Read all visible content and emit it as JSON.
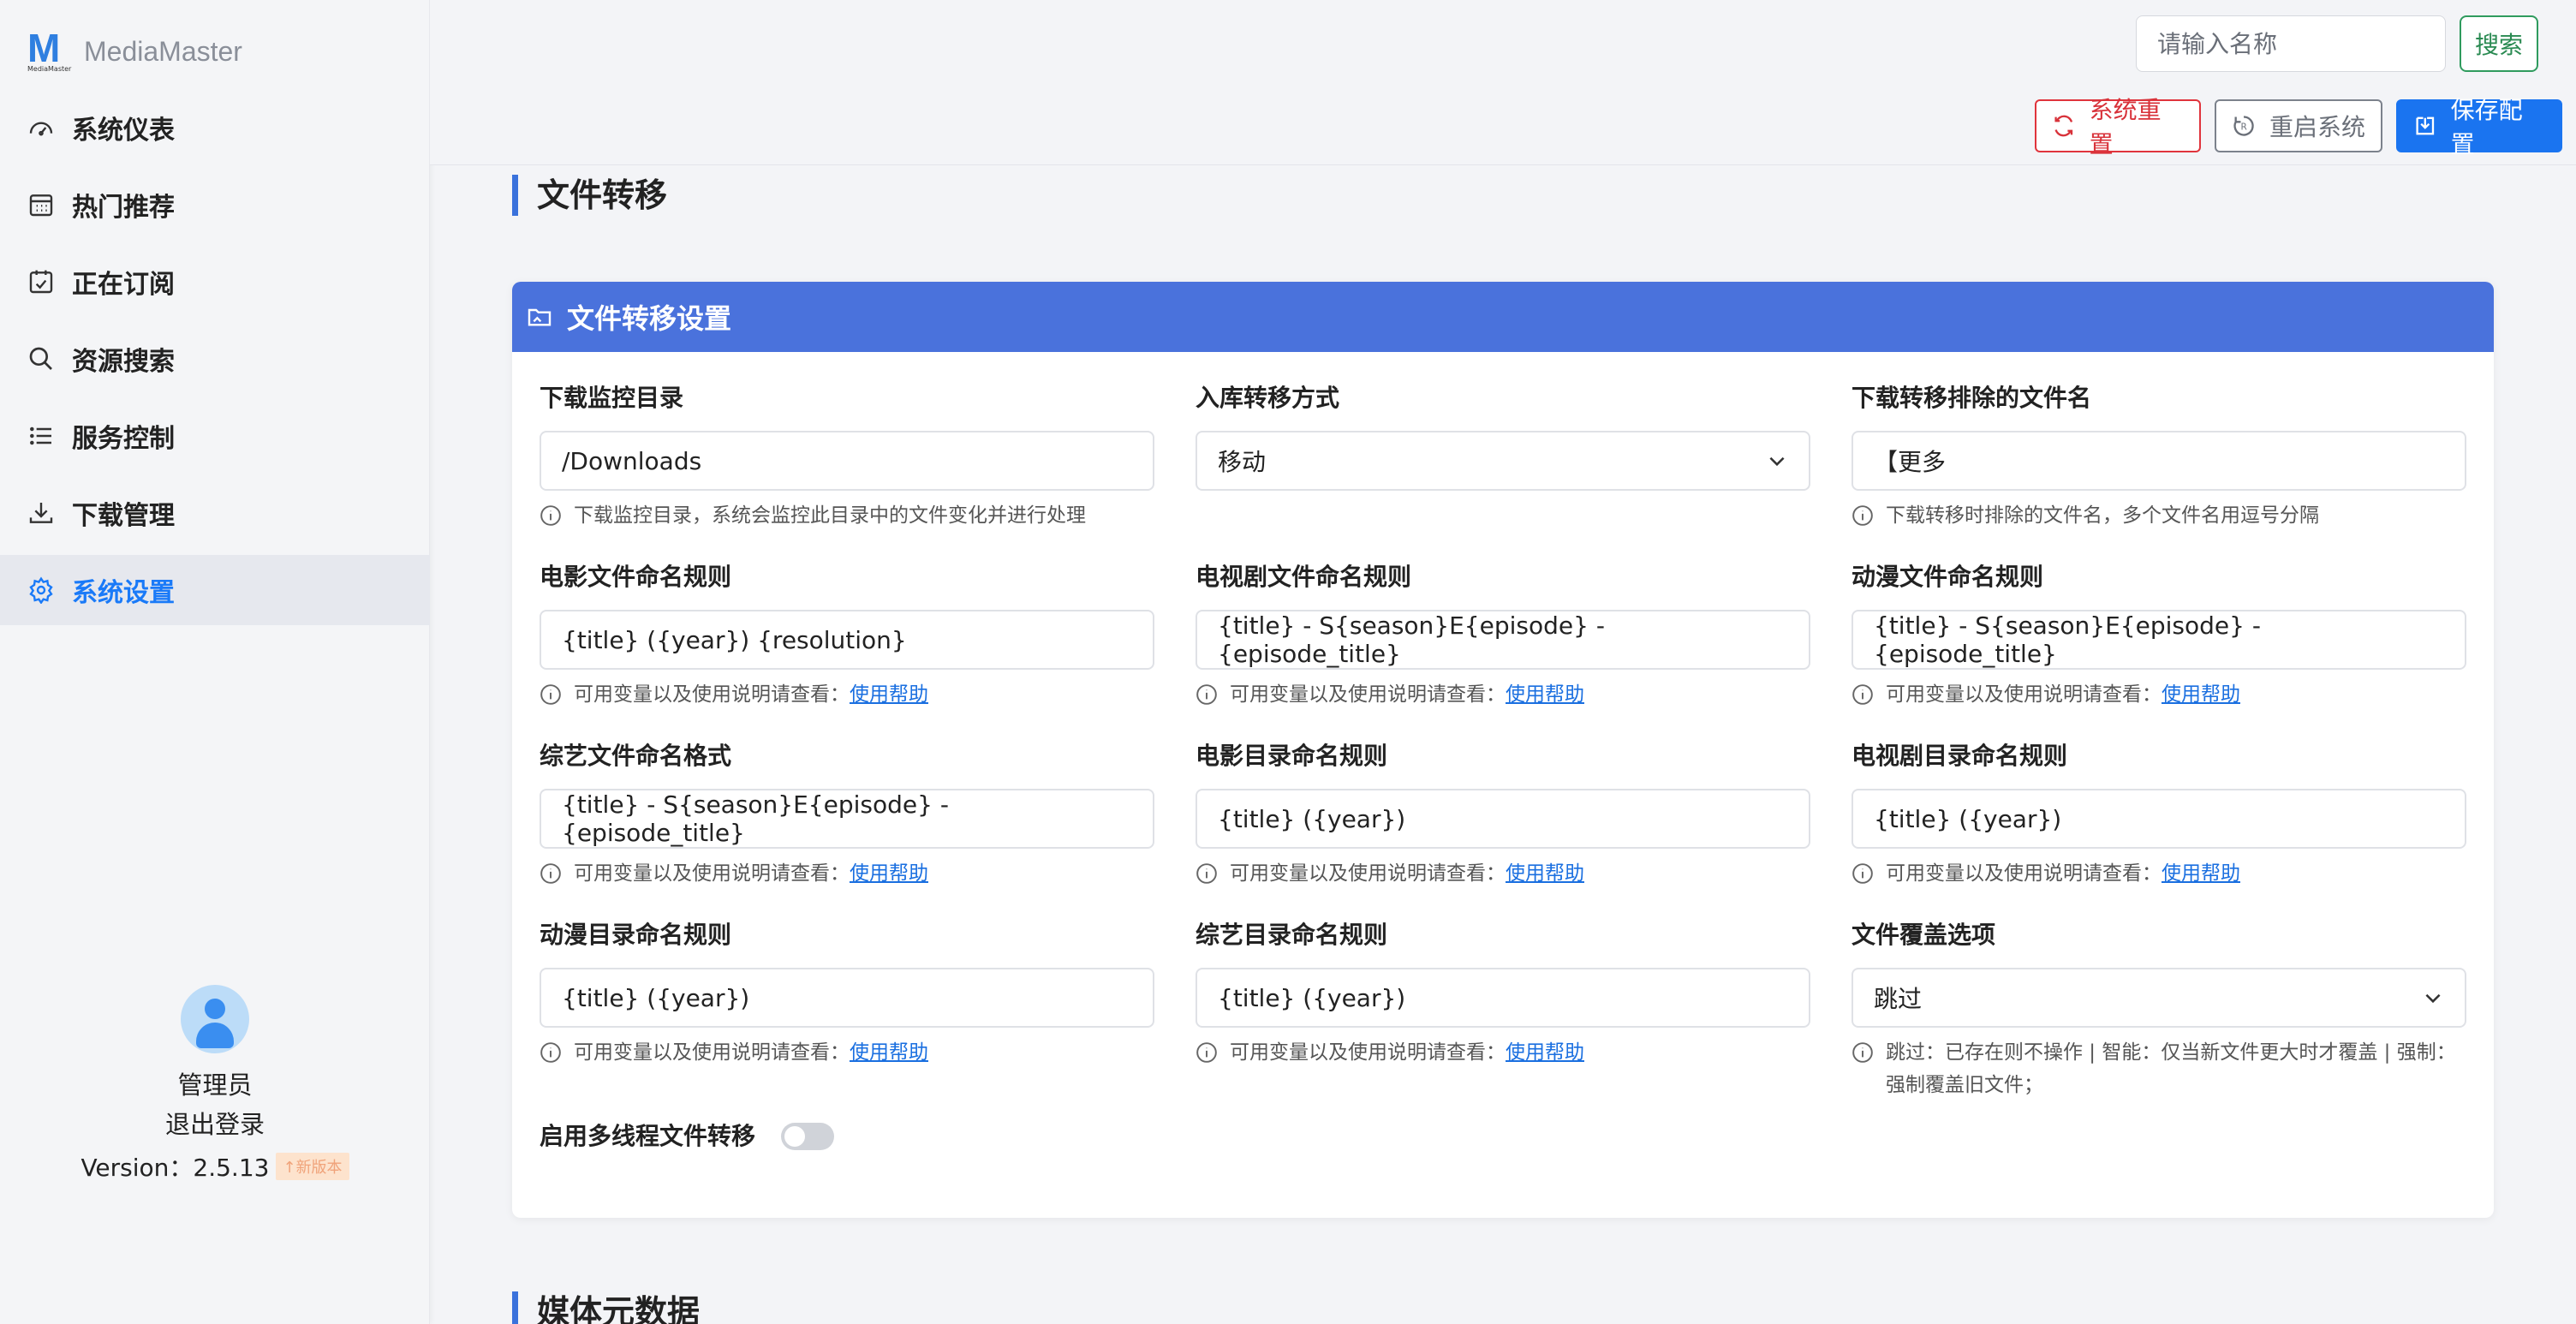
{
  "app": {
    "name": "MediaMaster",
    "logo_letter": "M",
    "logo_sub": "MediaMaster"
  },
  "sidebar": {
    "items": [
      {
        "label": "系统仪表",
        "icon": "dashboard-icon"
      },
      {
        "label": "热门推荐",
        "icon": "calendar-grid-icon"
      },
      {
        "label": "正在订阅",
        "icon": "calendar-check-icon"
      },
      {
        "label": "资源搜索",
        "icon": "search-icon"
      },
      {
        "label": "服务控制",
        "icon": "list-icon"
      },
      {
        "label": "下载管理",
        "icon": "download-icon"
      },
      {
        "label": "系统设置",
        "icon": "gear-icon",
        "active": true
      }
    ],
    "user": {
      "name": "管理员",
      "logout": "退出登录",
      "version_label": "Version：2.5.13",
      "new_badge": "新版本"
    }
  },
  "topbar": {
    "search_placeholder": "请输入名称",
    "search_button": "搜索",
    "reset_button": "系统重置",
    "restart_button": "重启系统",
    "save_button": "保存配置"
  },
  "page": {
    "section_title": "文件转移",
    "next_section_title": "媒体元数据",
    "card_title": "文件转移设置",
    "help_prefix": "可用变量以及使用说明请查看：",
    "help_link": "使用帮助",
    "fields": {
      "download_dir": {
        "label": "下载监控目录",
        "value": "/Downloads",
        "help": "下载监控目录，系统会监控此目录中的文件变化并进行处理"
      },
      "transfer_mode": {
        "label": "入库转移方式",
        "value": "移动"
      },
      "exclude_names": {
        "label": "下载转移排除的文件名",
        "value": "【更多",
        "help": "下载转移时排除的文件名，多个文件名用逗号分隔"
      },
      "movie_file_rule": {
        "label": "电影文件命名规则",
        "value": "{title} ({year}) {resolution}"
      },
      "tv_file_rule": {
        "label": "电视剧文件命名规则",
        "value": "{title} - S{season}E{episode} - {episode_title}"
      },
      "anime_file_rule": {
        "label": "动漫文件命名规则",
        "value": "{title} - S{season}E{episode} - {episode_title}"
      },
      "variety_file_rule": {
        "label": "综艺文件命名格式",
        "value": "{title} - S{season}E{episode} - {episode_title}"
      },
      "movie_dir_rule": {
        "label": "电影目录命名规则",
        "value": "{title} ({year})"
      },
      "tv_dir_rule": {
        "label": "电视剧目录命名规则",
        "value": "{title} ({year})"
      },
      "anime_dir_rule": {
        "label": "动漫目录命名规则",
        "value": "{title} ({year})"
      },
      "variety_dir_rule": {
        "label": "综艺目录命名规则",
        "value": "{title} ({year})"
      },
      "overwrite": {
        "label": "文件覆盖选项",
        "value": "跳过",
        "help": "跳过：已存在则不操作 | 智能：仅当新文件更大时才覆盖 | 强制：强制覆盖旧文件；"
      },
      "multithread": {
        "label": "启用多线程文件转移",
        "enabled": false
      }
    }
  },
  "colors": {
    "accent": "#1a74f0",
    "card_header": "#4a72dc",
    "danger": "#e0343c",
    "search_green": "#2f9b5e"
  }
}
